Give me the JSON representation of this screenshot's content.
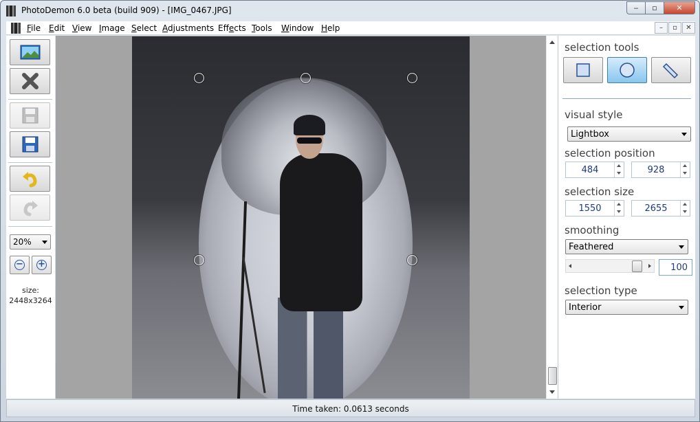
{
  "window": {
    "title": "PhotoDemon 6.0 beta (build 909) - [IMG_0467.JPG]",
    "minimize": "‒",
    "maximize": "▫",
    "close": "✕"
  },
  "menu": {
    "items": [
      {
        "underline": "F",
        "rest": "ile"
      },
      {
        "underline": "E",
        "rest": "dit"
      },
      {
        "underline": "V",
        "rest": "iew"
      },
      {
        "underline": "I",
        "rest": "mage"
      },
      {
        "underline": "S",
        "rest": "elect"
      },
      {
        "underline": "A",
        "rest": "djustments"
      },
      {
        "underline": "",
        "rest": "Eff",
        "underline2": "e",
        "rest2": "cts"
      },
      {
        "underline": "T",
        "rest": "ools"
      },
      {
        "underline": "W",
        "rest": "indow"
      },
      {
        "underline": "H",
        "rest": "elp"
      }
    ],
    "mdi": [
      "–",
      "▫",
      "✕"
    ]
  },
  "left_toolbar": {
    "zoom": "20%",
    "zoom_out": "−",
    "zoom_in": "+",
    "size_label": "size:",
    "size_value": "2448x3264"
  },
  "right_panel": {
    "selection_tools_label": "selection tools",
    "visual_style_label": "visual style",
    "visual_style_value": "Lightbox",
    "selection_position_label": "selection position",
    "position_x": "484",
    "position_y": "928",
    "selection_size_label": "selection size",
    "size_w": "1550",
    "size_h": "2655",
    "smoothing_label": "smoothing",
    "smoothing_value": "Feathered",
    "feather_value": "100",
    "feather_level": 100,
    "selection_type_label": "selection type",
    "selection_type_value": "Interior",
    "active_tool": "elliptical-selection"
  },
  "status": {
    "text": "Time taken: 0.0613 seconds"
  }
}
